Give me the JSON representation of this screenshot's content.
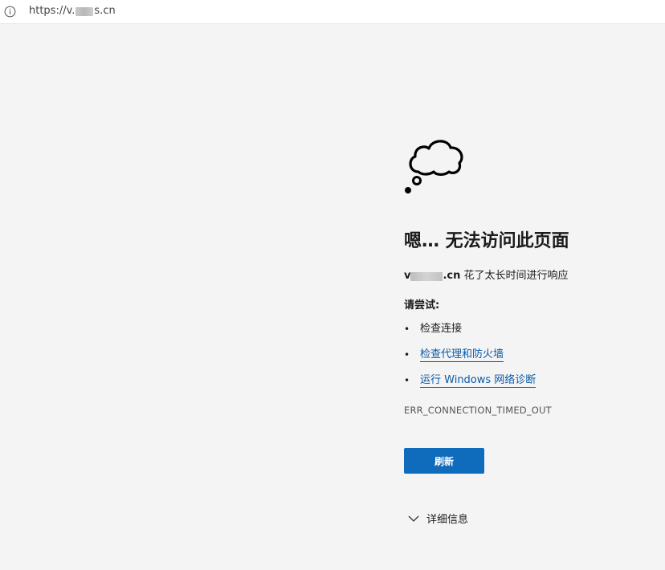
{
  "address_bar": {
    "url_prefix": "https://v.",
    "url_suffix": "s.cn"
  },
  "error_page": {
    "title": "嗯… 无法访问此页面",
    "host_prefix": "v",
    "host_suffix": ".cn",
    "message": "花了太长时间进行响应",
    "try_label": "请尝试:",
    "suggestions": [
      {
        "label": "检查连接",
        "link": false
      },
      {
        "label": "检查代理和防火墙",
        "link": true
      },
      {
        "label": "运行 Windows 网络诊断",
        "link": true
      }
    ],
    "error_code": "ERR_CONNECTION_TIMED_OUT",
    "refresh_label": "刷新",
    "details_label": "详细信息"
  },
  "colors": {
    "accent": "#0f6cbd",
    "link": "#0a5aa8",
    "background": "#f4f4f4"
  },
  "icons": {
    "site_info": "info-icon",
    "illustration": "cloud-icon",
    "expand": "chevron-down-icon"
  }
}
